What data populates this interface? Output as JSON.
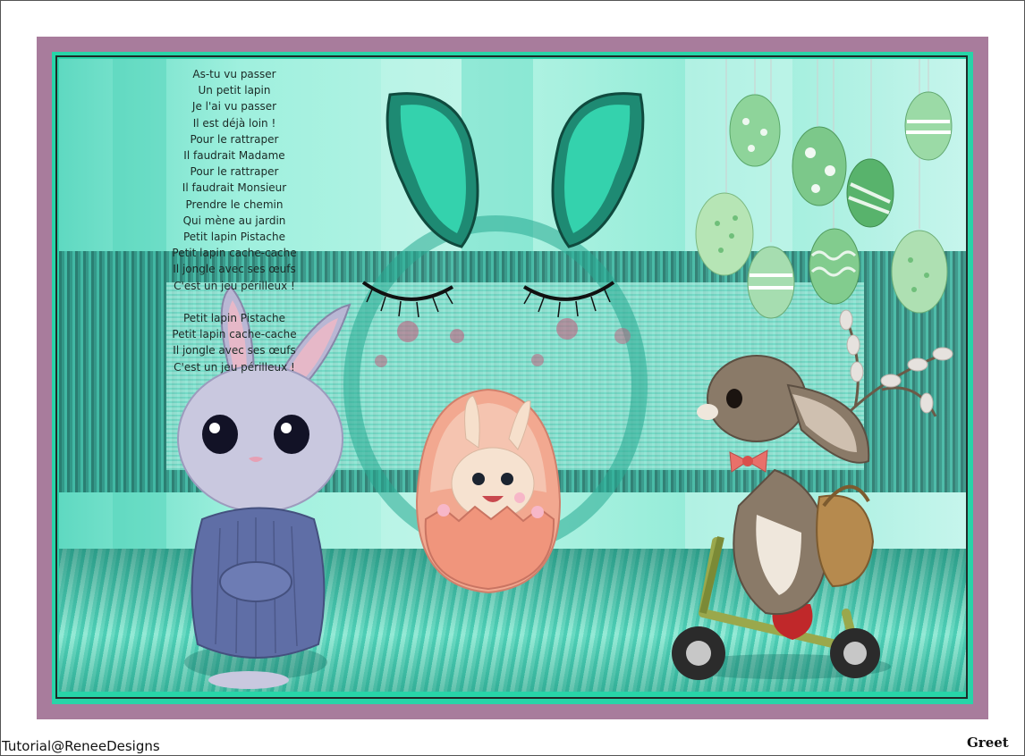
{
  "poem": {
    "lines": [
      "As-tu vu passer",
      "Un petit lapin",
      "Je l'ai vu passer",
      "Il est déjà loin !",
      "Pour le rattraper",
      "Il faudrait Madame",
      "Pour le rattraper",
      "Il faudrait Monsieur",
      "Prendre le chemin",
      "Qui mène au jardin",
      "Petit lapin Pistache",
      "Petit lapin cache-cache",
      "Il jongle avec ses œufs",
      "C'est un jeu périlleux !",
      "",
      "Petit lapin Pistache",
      "Petit lapin cache-cache",
      "Il jongle avec ses œufs",
      "C'est un jeu périlleux !"
    ]
  },
  "credits": {
    "tutorial": "Tutorial@ReneeDesigns",
    "artist": "Greet"
  },
  "colors": {
    "outer_frame": "#a87c9c",
    "inner_frame": "#28d4a8",
    "background": "#9ff0de"
  }
}
